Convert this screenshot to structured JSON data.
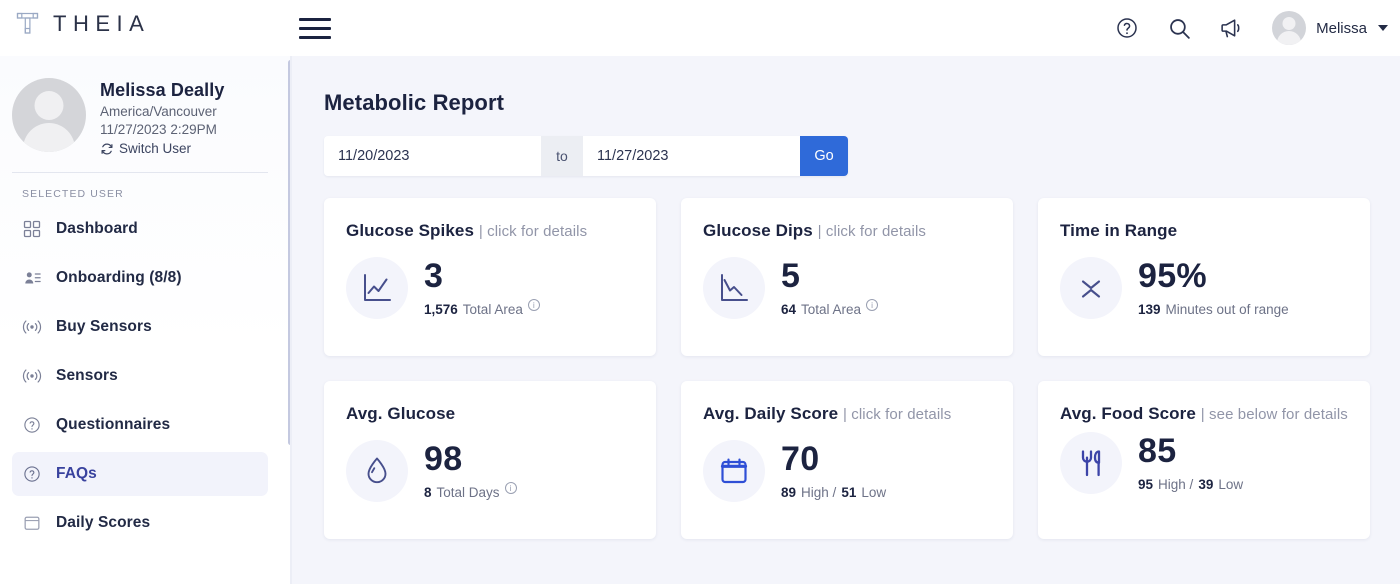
{
  "brand": {
    "name": "THEIA",
    "logo_icon": "theia-t-logo"
  },
  "header": {
    "menu_icon": "hamburger-menu-icon",
    "help_icon": "help-circle-icon",
    "search_icon": "search-icon",
    "announce_icon": "megaphone-icon",
    "avatar_icon": "user-avatar",
    "user_name": "Melissa",
    "caret_icon": "chevron-down-icon"
  },
  "sidebar": {
    "avatar_icon": "user-avatar",
    "user_name": "Melissa Deally",
    "timezone": "America/Vancouver",
    "datetime": "11/27/2023 2:29PM",
    "switch_user_label": "Switch User",
    "switch_user_icon": "refresh-icon",
    "section_label": "SELECTED USER",
    "items": [
      {
        "label": "Dashboard",
        "icon": "grid-icon",
        "active": false
      },
      {
        "label": "Onboarding (8/8)",
        "icon": "user-list-icon",
        "active": false
      },
      {
        "label": "Buy Sensors",
        "icon": "sensor-wave-icon",
        "active": false
      },
      {
        "label": "Sensors",
        "icon": "sensor-wave-icon",
        "active": false
      },
      {
        "label": "Questionnaires",
        "icon": "question-circle-icon",
        "active": false
      },
      {
        "label": "FAQs",
        "icon": "question-circle-icon",
        "active": true
      },
      {
        "label": "Daily Scores",
        "icon": "calendar-icon",
        "active": false
      }
    ],
    "scrollbar": "sidebar-scrollbar"
  },
  "main": {
    "page_title": "Metabolic Report",
    "date_from": "11/20/2023",
    "date_from_placeholder": "mm/dd/yyyy",
    "date_to": "11/27/2023",
    "date_to_placeholder": "mm/dd/yyyy",
    "separator_label": "to",
    "go_label": "Go",
    "accent_color": "#2f6ad9",
    "cards": [
      {
        "title": "Glucose Spikes",
        "subtitle": "| click for details",
        "icon": "line-chart-up-icon",
        "value": "3",
        "meta_value": "1,576",
        "meta_label": "Total Area",
        "has_info": true
      },
      {
        "title": "Glucose Dips",
        "subtitle": "| click for details",
        "icon": "line-chart-down-icon",
        "value": "5",
        "meta_value": "64",
        "meta_label": "Total Area",
        "has_info": true
      },
      {
        "title": "Time in Range",
        "subtitle": "",
        "icon": "range-chevrons-icon",
        "value": "95%",
        "meta_value": "139",
        "meta_label": "Minutes out of range",
        "has_info": false
      },
      {
        "title": "Avg. Glucose",
        "subtitle": "",
        "icon": "blood-drop-icon",
        "value": "98",
        "meta_value": "8",
        "meta_label": "Total Days",
        "has_info": true
      },
      {
        "title": "Avg. Daily Score",
        "subtitle": "| click for details",
        "icon": "calendar-icon",
        "value": "70",
        "meta_value": "89",
        "meta_label": "High /",
        "meta_value2": "51",
        "meta_label2": "Low",
        "has_info": false
      },
      {
        "title": "Avg. Food Score",
        "subtitle": "| see below for details",
        "icon": "fork-knife-icon",
        "value": "85",
        "meta_value": "95",
        "meta_label": "High /",
        "meta_value2": "39",
        "meta_label2": "Low",
        "has_info": false
      }
    ]
  }
}
